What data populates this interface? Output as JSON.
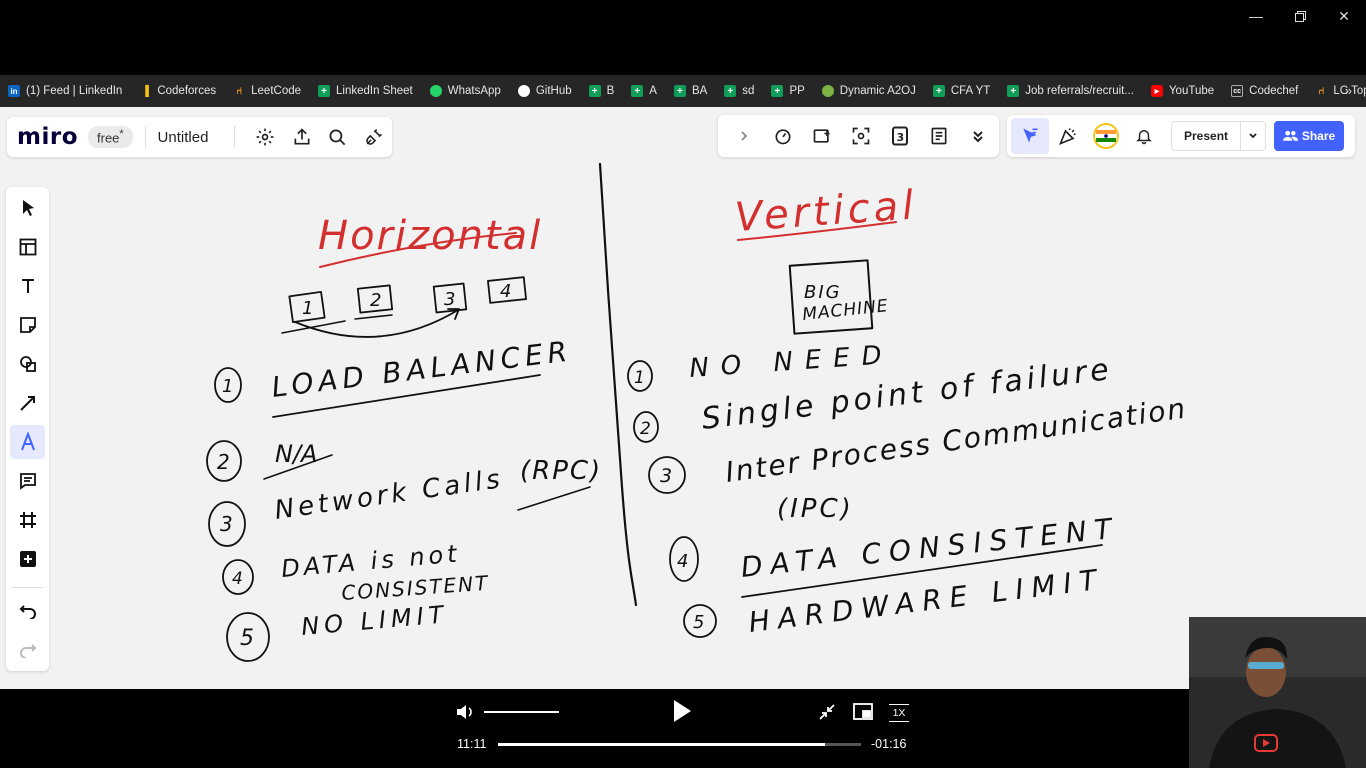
{
  "window": {
    "minimize_icon": "minimize-icon",
    "restore_icon": "restore-icon",
    "close_icon": "close-icon"
  },
  "bookmarks": {
    "items": [
      {
        "label": "(1) Feed | LinkedIn",
        "icon": "linkedin-icon",
        "color": "#0a66c2"
      },
      {
        "label": "Codeforces",
        "icon": "codeforces-icon",
        "color": "#f5c518"
      },
      {
        "label": "LeetCode",
        "icon": "leetcode-icon",
        "color": "#ffa116"
      },
      {
        "label": "LinkedIn Sheet",
        "icon": "sheets-icon",
        "color": "#0f9d58"
      },
      {
        "label": "WhatsApp",
        "icon": "whatsapp-icon",
        "color": "#25d366"
      },
      {
        "label": "GitHub",
        "icon": "github-icon",
        "color": "#ffffff"
      },
      {
        "label": "B",
        "icon": "sheets-icon",
        "color": "#0f9d58"
      },
      {
        "label": "A",
        "icon": "sheets-icon",
        "color": "#0f9d58"
      },
      {
        "label": "BA",
        "icon": "sheets-icon",
        "color": "#0f9d58"
      },
      {
        "label": "sd",
        "icon": "sheets-icon",
        "color": "#0f9d58"
      },
      {
        "label": "PP",
        "icon": "sheets-icon",
        "color": "#0f9d58"
      },
      {
        "label": "Dynamic A2OJ",
        "icon": "a2oj-icon",
        "color": "#7cb342"
      },
      {
        "label": "CFA YT",
        "icon": "sheets-icon",
        "color": "#0f9d58"
      },
      {
        "label": "Job referrals/recruit...",
        "icon": "sheets-icon",
        "color": "#0f9d58"
      },
      {
        "label": "YouTube",
        "icon": "youtube-icon",
        "color": "#ff0000"
      },
      {
        "label": "Codechef",
        "icon": "codechef-icon",
        "color": "#8d6e63"
      },
      {
        "label": "LC Topic",
        "icon": "leetcode-icon",
        "color": "#ffa116"
      }
    ],
    "more": "»"
  },
  "miro": {
    "logo": "miro",
    "plan_badge": "free",
    "plan_asterisk": "*",
    "board_title": "Untitled",
    "present_label": "Present",
    "share_label": "Share",
    "accent": "#4262ff"
  },
  "board": {
    "horizontal": {
      "title": "Horizontal",
      "servers": [
        "1",
        "2",
        "3",
        "4"
      ],
      "points": [
        {
          "num": "1",
          "text": "LOAD BALANCER"
        },
        {
          "num": "2",
          "text": "N/A"
        },
        {
          "num": "3",
          "text": "Network Calls",
          "extra": "(RPC)"
        },
        {
          "num": "4",
          "text": "DATA is not",
          "text2": "CONSISTENT"
        },
        {
          "num": "5",
          "text": "NO LIMIT"
        }
      ]
    },
    "vertical": {
      "title": "Vertical",
      "machine": [
        "BIG",
        "MACHINE"
      ],
      "points": [
        {
          "num": "1",
          "text": "NO NEED"
        },
        {
          "num": "2",
          "text": "Single point of failure"
        },
        {
          "num": "3",
          "text": "Inter Process Communication",
          "text2": "(IPC)"
        },
        {
          "num": "4",
          "text": "DATA CONSISTENT"
        },
        {
          "num": "5",
          "text": "HARDWARE LIMIT"
        }
      ]
    },
    "ink_red": "#d32f2f",
    "ink_black": "#111111"
  },
  "player": {
    "elapsed": "11:11",
    "remaining": "-01:16",
    "speed": "1X",
    "progress": 0.9,
    "volume": 1.0
  }
}
